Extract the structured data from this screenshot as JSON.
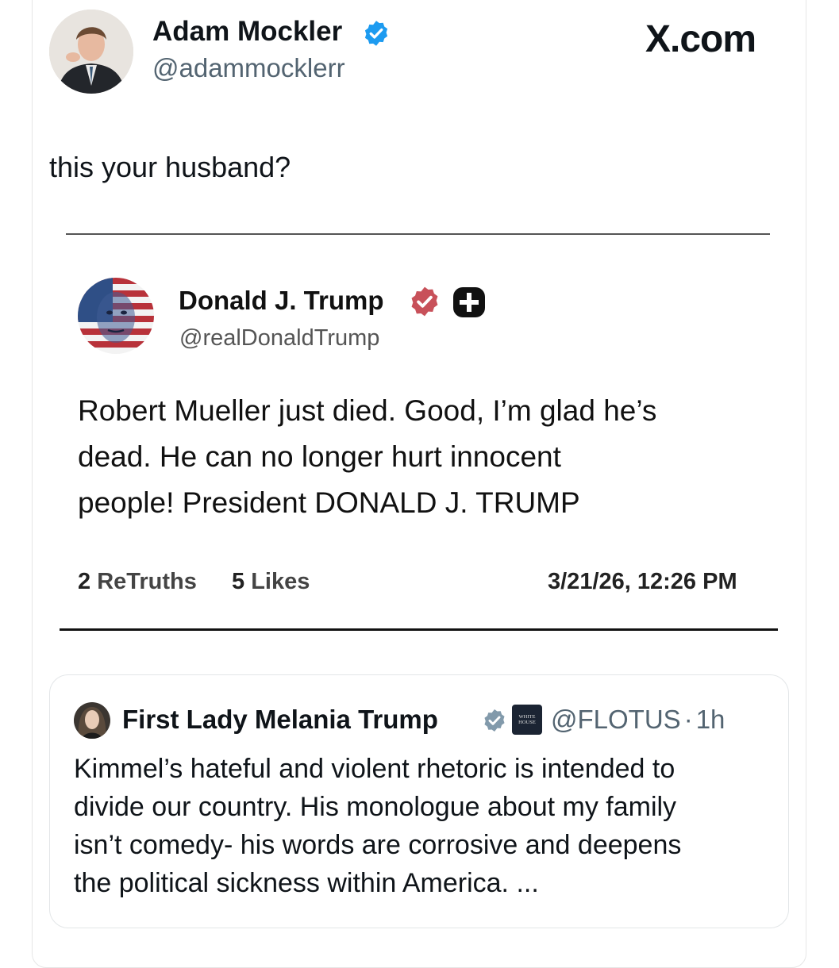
{
  "site": {
    "brand": "X.com"
  },
  "tweet": {
    "author_name": "Adam Mockler",
    "author_handle": "@adammocklerr",
    "text": "this your husband?"
  },
  "truth_post": {
    "author_name": "Donald J. Trump",
    "author_handle": "@realDonaldTrump",
    "lines": [
      "Robert Mueller just died. Good, I’m glad he’s",
      "dead. He can no longer hurt innocent",
      "people! President DONALD J. TRUMP"
    ],
    "retruths_count": "2",
    "retruths_label": "ReTruths",
    "likes_count": "5",
    "likes_label": "Likes",
    "timestamp": "3/21/26, 12:26 PM"
  },
  "quoted_tweet": {
    "author_name": "First Lady Melania Trump",
    "affiliate_badge_text": "WHITE HOUSE",
    "author_handle": "@FLOTUS",
    "separator": "·",
    "time_ago": "1h",
    "lines": [
      "Kimmel’s hateful and violent rhetoric is intended to",
      "divide our country.  His monologue about my family",
      "isn’t comedy- his words are corrosive and deepens",
      "the political sickness within America.  ..."
    ]
  },
  "colors": {
    "x_verified_blue": "#1d9bf0",
    "truth_badge_red": "#c8515a",
    "handle_gray": "#536471"
  },
  "icons": {
    "tweet_verified": "verified-badge-icon",
    "truth_verified": "truth-verified-badge-icon",
    "truth_plus": "plus-badge-icon",
    "flotus_verified": "gray-verified-badge-icon"
  }
}
